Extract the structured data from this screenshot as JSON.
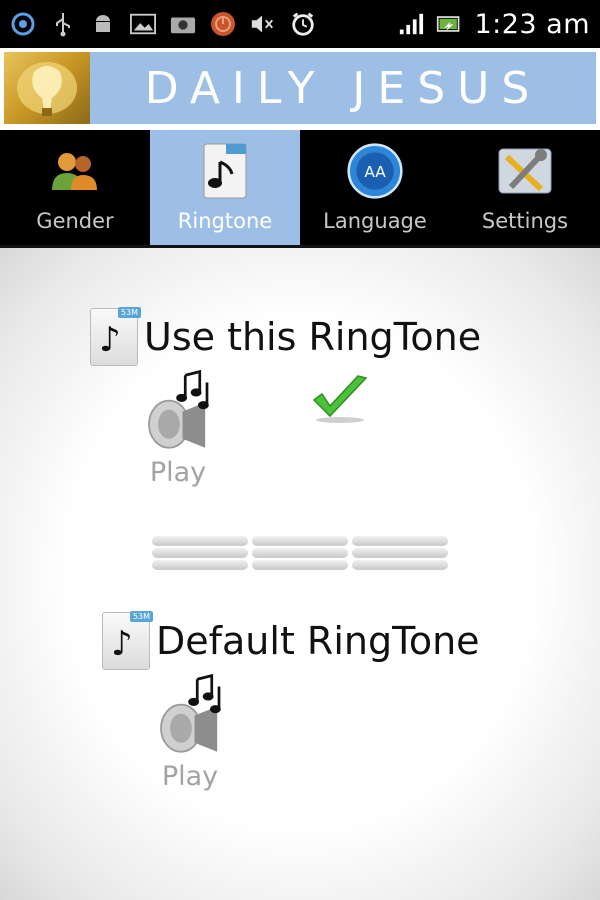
{
  "status_bar": {
    "time": "1:23 am",
    "icons": [
      "sync-icon",
      "usb-icon",
      "android-icon",
      "image-icon",
      "camera-icon",
      "power-icon",
      "mute-icon",
      "alarm-icon",
      "signal-icon",
      "battery-icon"
    ]
  },
  "header": {
    "title": "DAILY JESUS",
    "accent_color": "#9dbfe6"
  },
  "tabs": [
    {
      "label": "Gender",
      "icon": "people-icon",
      "active": false
    },
    {
      "label": "Ringtone",
      "icon": "music-file-icon",
      "active": true
    },
    {
      "label": "Language",
      "icon": "language-globe-icon",
      "active": false
    },
    {
      "label": "Settings",
      "icon": "tools-icon",
      "active": false
    }
  ],
  "ringtones": [
    {
      "title": "Use this RingTone",
      "play_label": "Play",
      "selected": true
    },
    {
      "title": "Default RingTone",
      "play_label": "Play",
      "selected": false
    }
  ]
}
